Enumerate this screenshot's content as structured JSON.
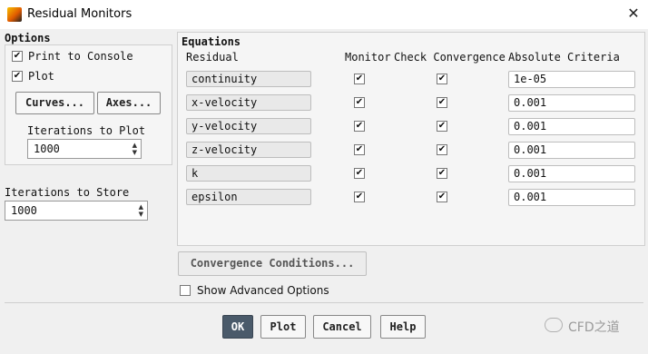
{
  "window": {
    "title": "Residual Monitors",
    "close_symbol": "✕"
  },
  "options": {
    "title": "Options",
    "print_to_console": {
      "label": "Print to Console",
      "checked": true
    },
    "plot": {
      "label": "Plot",
      "checked": true
    },
    "curves_button": "Curves...",
    "axes_button": "Axes...",
    "iterations_to_plot": {
      "label": "Iterations to Plot",
      "value": "1000"
    }
  },
  "iterations_to_store": {
    "label": "Iterations to Store",
    "value": "1000"
  },
  "equations": {
    "title": "Equations",
    "headers": {
      "residual": "Residual",
      "monitor": "Monitor",
      "check_convergence": "Check Convergence",
      "absolute_criteria": "Absolute Criteria"
    },
    "rows": [
      {
        "name": "continuity",
        "monitor": true,
        "check": true,
        "criteria": "1e-05"
      },
      {
        "name": "x-velocity",
        "monitor": true,
        "check": true,
        "criteria": "0.001"
      },
      {
        "name": "y-velocity",
        "monitor": true,
        "check": true,
        "criteria": "0.001"
      },
      {
        "name": "z-velocity",
        "monitor": true,
        "check": true,
        "criteria": "0.001"
      },
      {
        "name": "k",
        "monitor": true,
        "check": true,
        "criteria": "0.001"
      },
      {
        "name": "epsilon",
        "monitor": true,
        "check": true,
        "criteria": "0.001"
      }
    ]
  },
  "convergence_conditions_button": "Convergence Conditions...",
  "show_advanced": {
    "label": "Show Advanced Options",
    "checked": false
  },
  "buttons": {
    "ok": "OK",
    "plot": "Plot",
    "cancel": "Cancel",
    "help": "Help"
  },
  "watermark": "CFD之道",
  "colors": {
    "ok_button": "#4a5a6a"
  }
}
